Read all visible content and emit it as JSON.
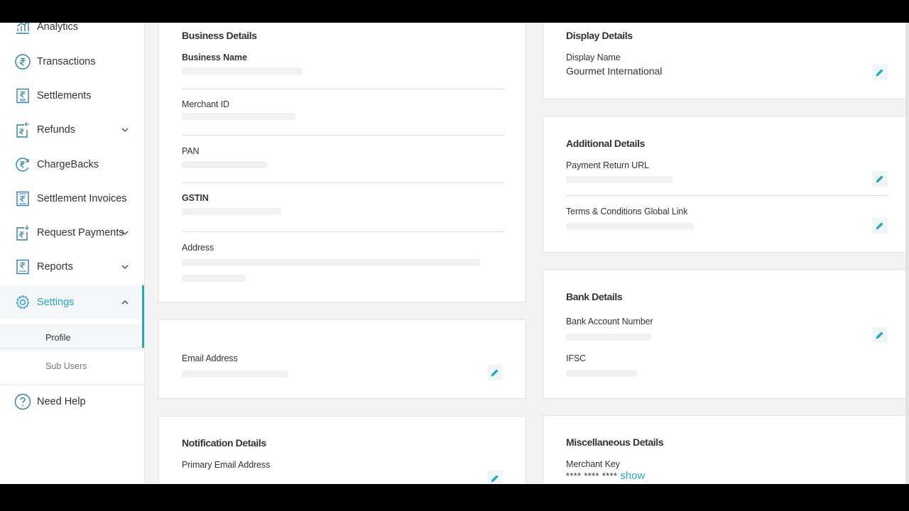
{
  "sidebar": {
    "items": [
      {
        "label": "Analytics",
        "icon": "analytics-icon"
      },
      {
        "label": "Transactions",
        "icon": "rupee-circle-icon"
      },
      {
        "label": "Settlements",
        "icon": "settlements-icon"
      },
      {
        "label": "Refunds",
        "icon": "refund-icon"
      },
      {
        "label": "ChargeBacks",
        "icon": "chargeback-icon"
      },
      {
        "label": "Settlement Invoices",
        "icon": "invoice-icon"
      },
      {
        "label": "Request Payments",
        "icon": "request-payment-icon"
      },
      {
        "label": "Reports",
        "icon": "reports-icon"
      },
      {
        "label": "Settings",
        "icon": "gear-icon"
      }
    ],
    "sub_items": [
      {
        "label": "Profile"
      },
      {
        "label": "Sub Users"
      }
    ],
    "help": {
      "label": "Need Help",
      "icon": "help-icon"
    },
    "accent_color": "#26a6c5"
  },
  "business_details": {
    "title": "Business Details",
    "fields": [
      {
        "label": "Business Name"
      },
      {
        "label": "Merchant ID"
      },
      {
        "label": "PAN"
      },
      {
        "label": "GSTIN"
      },
      {
        "label": "Address"
      }
    ]
  },
  "email_card": {
    "label": "Email Address"
  },
  "notification_details": {
    "title": "Notification Details",
    "primary_email_label": "Primary Email Address"
  },
  "display_details": {
    "title": "Display Details",
    "display_name_label": "Display Name",
    "display_name_value": "Gourmet International"
  },
  "additional_details": {
    "title": "Additional Details",
    "payment_return_url_label": "Payment Return URL",
    "terms_label": "Terms & Conditions Global Link"
  },
  "bank_details": {
    "title": "Bank Details",
    "account_number_label": "Bank Account Number",
    "ifsc_label": "IFSC"
  },
  "misc_details": {
    "title": "Miscellaneous Details",
    "merchant_key_label": "Merchant Key",
    "merchant_key_masked": "**** **** **** ",
    "show_label": "show"
  }
}
